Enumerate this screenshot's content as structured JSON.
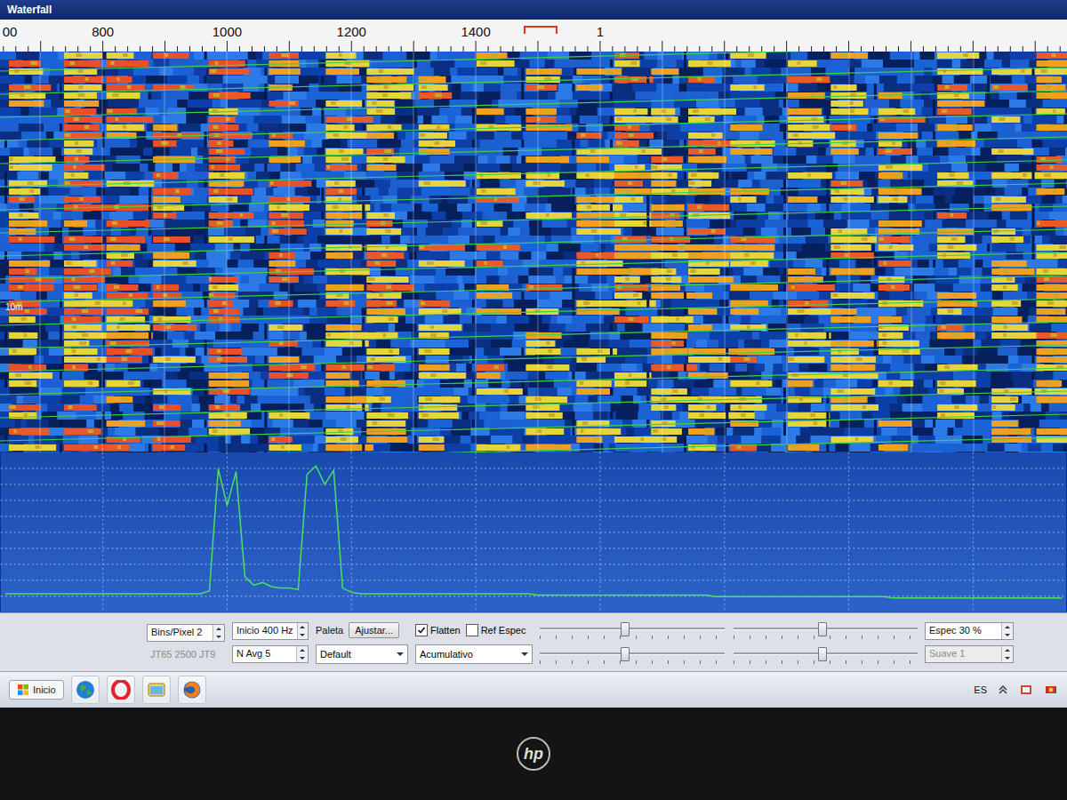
{
  "window": {
    "title": "Waterfall"
  },
  "ruler": {
    "labels": [
      "00",
      "800",
      "1000",
      "1200",
      "1400",
      "1"
    ]
  },
  "waterfall": {
    "band_label": "10m"
  },
  "spectrum": {
    "values": [
      8,
      8,
      8,
      8,
      8,
      8,
      8,
      8,
      8,
      8,
      8,
      8,
      8,
      8,
      8,
      8,
      8,
      8,
      8,
      8,
      8,
      8,
      8,
      10,
      96,
      70,
      94,
      20,
      14,
      16,
      13,
      12,
      12,
      11,
      92,
      98,
      85,
      95,
      12,
      9,
      8,
      8,
      8,
      8,
      8,
      8,
      8,
      8,
      8,
      8,
      8,
      8,
      8,
      8,
      8,
      8,
      8,
      8,
      8,
      8,
      7,
      7,
      7,
      7,
      7,
      7,
      7,
      7,
      7,
      7,
      7,
      7,
      7,
      7,
      7,
      7,
      7,
      7,
      7,
      7,
      6,
      6,
      6,
      6,
      6,
      6,
      6,
      6,
      6,
      6,
      6,
      6,
      6,
      6,
      6,
      6,
      6,
      6,
      6,
      6,
      5,
      5,
      5,
      5,
      5,
      5,
      5,
      5,
      5,
      5,
      5,
      5,
      5,
      5,
      5,
      5,
      5,
      5,
      5,
      5
    ]
  },
  "controls": {
    "bins_per_pixel": "Bins/Pixel 2",
    "modes": {
      "text": "JT65 2500 JT9",
      "disabled": true
    },
    "start": "Inicio 400 Hz",
    "n_avg": "N Avg 5",
    "palette": {
      "label": "Paleta",
      "button": "Ajustar...",
      "value": "Default"
    },
    "checkboxes": [
      {
        "label": "Flatten",
        "checked": true
      },
      {
        "label": "Ref Espec",
        "checked": false
      }
    ],
    "spectrum_type": "Acumulativo",
    "sliders": [
      {
        "level": 0.46
      },
      {
        "level": 0.48
      },
      {
        "level": 0.46
      },
      {
        "level": 0.48
      }
    ],
    "spec": {
      "text": "Espec 30 %",
      "disabled": false
    },
    "smooth": {
      "text": "Suave 1",
      "disabled": true
    }
  },
  "taskbar": {
    "start": "Inicio",
    "tray": {
      "language": "ES"
    }
  },
  "bezel": {
    "logo": "hp"
  }
}
